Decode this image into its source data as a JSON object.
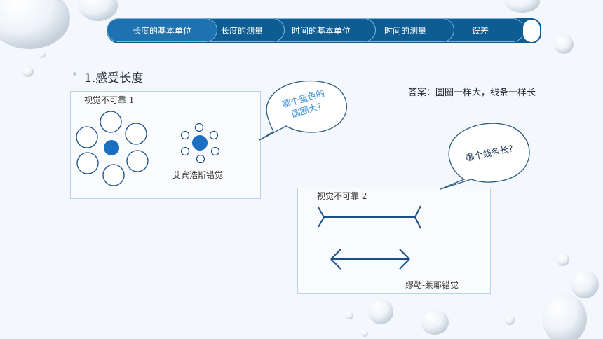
{
  "nav": {
    "tabs": [
      {
        "label": "长度的基本单位"
      },
      {
        "label": "长度的测量"
      },
      {
        "label": "时间的基本单位"
      },
      {
        "label": "时间的测量"
      },
      {
        "label": "误差"
      }
    ]
  },
  "section": {
    "title": "1.感受长度"
  },
  "answer": "答案：圆圈一样大，线条一样长",
  "illusion1": {
    "label": "视觉不可靠 1",
    "caption": "艾宾浩斯错觉"
  },
  "illusion2": {
    "label": "视觉不可靠 2",
    "caption": "缪勒-莱耶错觉"
  },
  "bubble1": {
    "line1": "哪个蓝色的",
    "line2": "圆圈大?"
  },
  "bubble2": {
    "text": "哪个线条长?"
  },
  "colors": {
    "navy": "#0c5d93",
    "blue_circle": "#1a6fc1",
    "panel_border": "#b8d4ec",
    "bubble1_text": "#3a8fd8",
    "bubble2_text": "#1c3550"
  }
}
